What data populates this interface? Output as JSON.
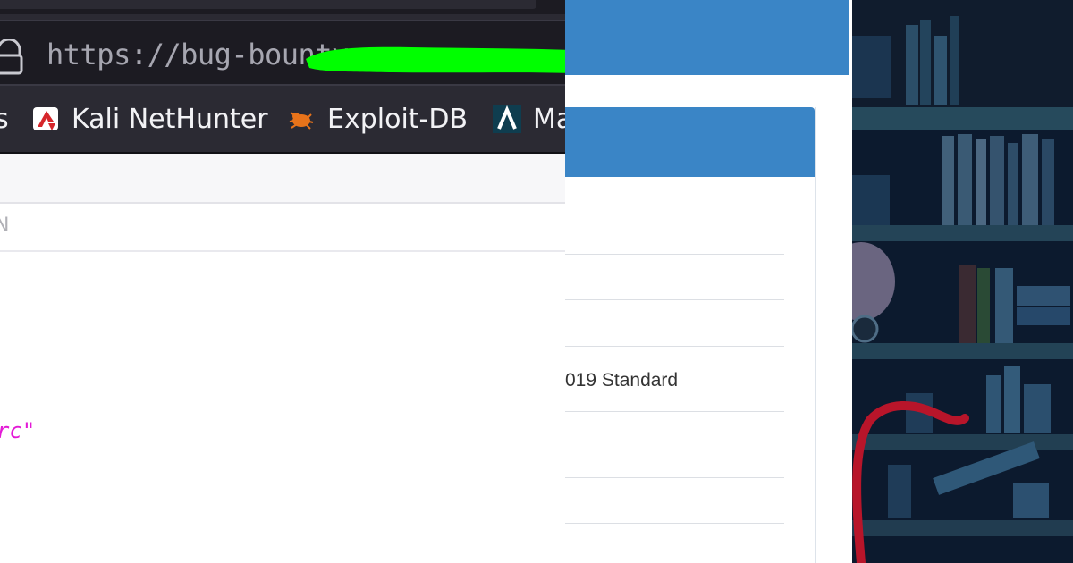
{
  "browser": {
    "url_visible": "https://bug-bounty",
    "bookmarks": [
      {
        "label": "s",
        "icon": "none"
      },
      {
        "label": "Kali NetHunter",
        "icon": "kali-nethunter-icon"
      },
      {
        "label": "Exploit-DB",
        "icon": "exploit-db-icon"
      },
      {
        "label": "Ma",
        "icon": "maltego-icon"
      }
    ],
    "content_label": "N",
    "code_fragment": "rc\""
  },
  "webpage": {
    "row_text": "019 Standard",
    "accent_color": "#3a85c6"
  },
  "colors": {
    "toolbar_dark": "#2b2a33",
    "url_field_dark": "#1c1b22",
    "redaction_green": "#00ff00",
    "code_magenta": "#e31ad6"
  }
}
